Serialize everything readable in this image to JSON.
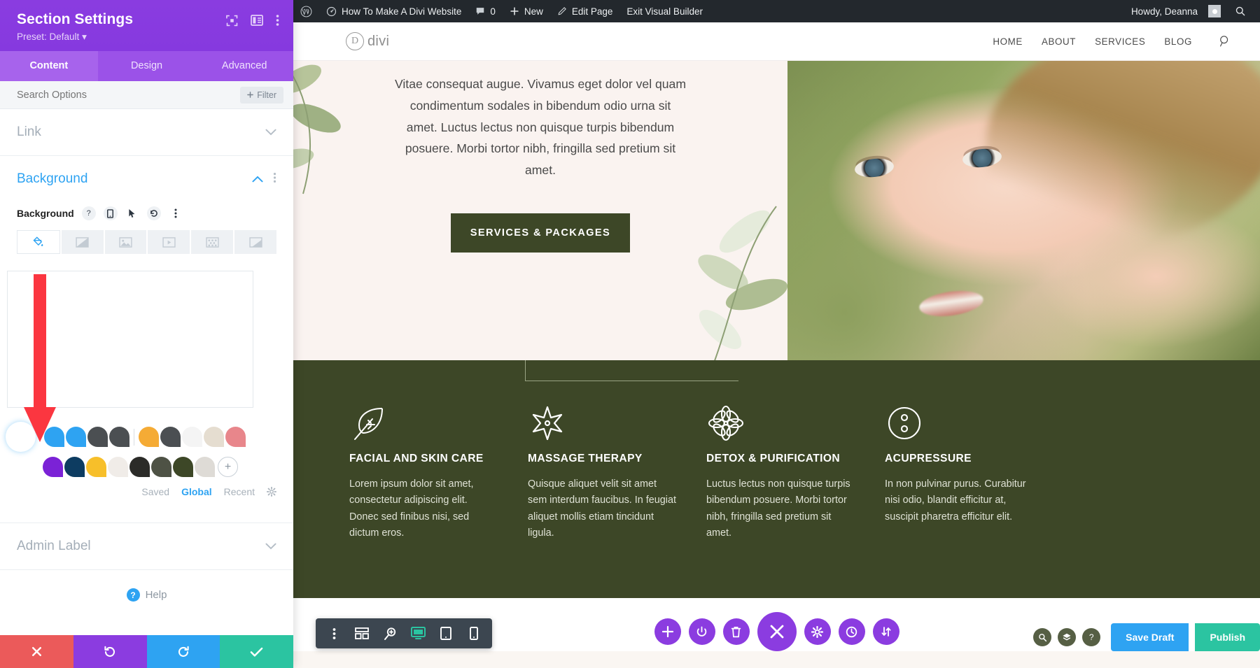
{
  "settings_panel": {
    "title": "Section Settings",
    "preset": "Preset: Default",
    "preset_caret": "▾",
    "header_icons": [
      {
        "name": "focus-icon",
        "glyph": "⬚"
      },
      {
        "name": "layout-toggle-icon",
        "glyph": "▤"
      },
      {
        "name": "more-options-icon",
        "glyph": "⋮"
      }
    ],
    "tabs": [
      {
        "label": "Content",
        "active": true
      },
      {
        "label": "Design",
        "active": false
      },
      {
        "label": "Advanced",
        "active": false
      }
    ],
    "search": {
      "placeholder": "Search Options",
      "value": ""
    },
    "filter_button": "Filter",
    "filter_icon": "+",
    "sections": [
      {
        "label": "Link",
        "open": false
      },
      {
        "label": "Background",
        "open": true
      },
      {
        "label": "Admin Label",
        "open": false
      }
    ],
    "background": {
      "field_label": "Background",
      "field_icons": [
        "help-icon",
        "responsive-icon",
        "hover-icon",
        "reset-icon",
        "more-icon"
      ],
      "type_tabs": [
        {
          "name": "background-color-tab",
          "active": true
        },
        {
          "name": "background-gradient-tab",
          "active": false
        },
        {
          "name": "background-image-tab",
          "active": false
        },
        {
          "name": "background-video-tab",
          "active": false
        },
        {
          "name": "background-pattern-tab",
          "active": false
        },
        {
          "name": "background-mask-tab",
          "active": false
        }
      ],
      "preview_color": "#3d4727",
      "selected_swatch_color": "#3d4727",
      "swatch_rows": [
        [
          "#2ea3f2",
          "#2ea3f2",
          "#4b4f52",
          "#4b4f52",
          "|",
          "#f5ab35",
          "#4b4f52",
          "#f4f4f4",
          "#e5ddd0",
          "#e8868b"
        ],
        [
          "#7b22d6",
          "#0d3c61",
          "#f7bf2a",
          "#f0ece8",
          "#2b2b28",
          "#4e5245",
          "#3d4727",
          "#dedbd6",
          "+"
        ]
      ],
      "swatch_tabs": [
        {
          "label": "Saved",
          "active": false
        },
        {
          "label": "Global",
          "active": true
        },
        {
          "label": "Recent",
          "active": false
        }
      ],
      "swatch_settings_icon": "gear-icon"
    },
    "help_label": "Help",
    "footer_buttons": [
      {
        "name": "discard-button",
        "glyph": "✕",
        "color": "#eb5a5a"
      },
      {
        "name": "undo-button",
        "glyph": "↺",
        "color": "#8b3ce0"
      },
      {
        "name": "redo-button",
        "glyph": "↻",
        "color": "#2ea3f2"
      },
      {
        "name": "save-button",
        "glyph": "✓",
        "color": "#2bc4a1"
      }
    ]
  },
  "admin_bar": {
    "wp_logo": "wordpress-logo-icon",
    "site_name": "How To Make A Divi Website",
    "comment_count": "0",
    "new_label": "New",
    "edit_page_label": "Edit Page",
    "exit_builder_label": "Exit Visual Builder",
    "howdy": "Howdy, Deanna",
    "search_icon": "search-icon"
  },
  "site_nav": {
    "logo_mark": "D",
    "logo_text": "divi",
    "menu": [
      "HOME",
      "ABOUT",
      "SERVICES",
      "BLOG"
    ],
    "search_icon": "search-icon"
  },
  "hero": {
    "paragraph": "Vitae consequat augue. Vivamus eget dolor vel quam condimentum sodales in bibendum odio urna sit amet. Luctus lectus non quisque turpis bibendum posuere. Morbi tortor nibh, fringilla sed pretium sit amet.",
    "button_label": "SERVICES & PACKAGES"
  },
  "services": {
    "background_color": "#3d4727",
    "items": [
      {
        "icon": "leaf-icon",
        "title": "FACIAL AND SKIN CARE",
        "desc": "Lorem ipsum dolor sit amet, consectetur adipiscing elit. Donec sed finibus nisi, sed dictum eros."
      },
      {
        "icon": "star-flower-icon",
        "title": "MASSAGE THERAPY",
        "desc": "Quisque aliquet velit sit amet sem interdum faucibus. In feugiat aliquet mollis etiam tincidunt ligula."
      },
      {
        "icon": "flower-icon",
        "title": "DETOX & PURIFICATION",
        "desc": "Luctus lectus non quisque turpis bibendum posuere. Morbi tortor nibh, fringilla sed pretium sit amet."
      },
      {
        "icon": "acupressure-icon",
        "title": "ACUPRESSURE",
        "desc": "In non pulvinar purus. Curabitur nisi odio, blandit efficitur at, suscipit pharetra efficitur elit."
      }
    ]
  },
  "divi_toolbar": {
    "left_buttons": [
      {
        "name": "toolbar-more-icon",
        "glyph": "⋮",
        "active": false
      },
      {
        "name": "wireframe-view-icon",
        "glyph": "▤",
        "active": false
      },
      {
        "name": "zoom-out-view-icon",
        "glyph": "⌕",
        "active": false
      },
      {
        "name": "desktop-view-icon",
        "glyph": "🖳",
        "active": true
      },
      {
        "name": "tablet-view-icon",
        "glyph": "▭",
        "active": false
      },
      {
        "name": "phone-view-icon",
        "glyph": "▯",
        "active": false
      }
    ],
    "center_buttons": [
      {
        "name": "add-section-button",
        "glyph": "+"
      },
      {
        "name": "power-button",
        "glyph": "⏻"
      },
      {
        "name": "trash-button",
        "glyph": "🗑"
      },
      {
        "name": "close-builder-button",
        "glyph": "✕"
      },
      {
        "name": "settings-button",
        "glyph": "✹"
      },
      {
        "name": "history-button",
        "glyph": "◷"
      },
      {
        "name": "portability-button",
        "glyph": "↓↑"
      }
    ],
    "right_icons": [
      {
        "name": "search-icon",
        "glyph": "⌕"
      },
      {
        "name": "layers-icon",
        "glyph": "❖"
      },
      {
        "name": "help-icon",
        "glyph": "?"
      }
    ],
    "save_draft_label": "Save Draft",
    "publish_label": "Publish"
  }
}
